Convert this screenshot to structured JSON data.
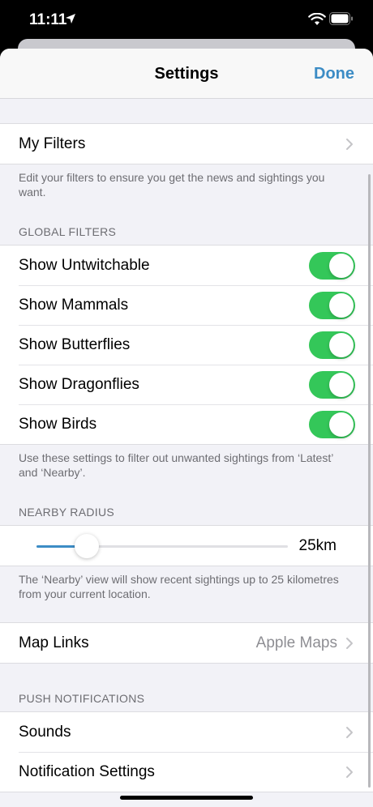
{
  "status": {
    "time": "11:11"
  },
  "nav": {
    "title": "Settings",
    "done": "Done"
  },
  "my_filters": {
    "label": "My Filters",
    "footnote": "Edit your filters to ensure you get the news and sightings you want."
  },
  "global_filters": {
    "header": "GLOBAL FILTERS",
    "items": [
      {
        "label": "Show Untwitchable",
        "on": true
      },
      {
        "label": "Show Mammals",
        "on": true
      },
      {
        "label": "Show Butterflies",
        "on": true
      },
      {
        "label": "Show Dragonflies",
        "on": true
      },
      {
        "label": "Show Birds",
        "on": true
      }
    ],
    "footnote": "Use these settings to filter out unwanted sightings from ‘Latest’ and ‘Nearby’."
  },
  "nearby_radius": {
    "header": "NEARBY RADIUS",
    "value_label": "25km",
    "fraction": 0.2,
    "footnote": "The ‘Nearby’ view will show recent sightings up to 25 kilometres from your current location."
  },
  "map_links": {
    "label": "Map Links",
    "value": "Apple Maps"
  },
  "push_notifications": {
    "header": "PUSH NOTIFICATIONS",
    "items": [
      {
        "label": "Sounds"
      },
      {
        "label": "Notification Settings"
      }
    ]
  },
  "colors": {
    "accent": "#3c8cc5",
    "toggle_on": "#34c759"
  }
}
